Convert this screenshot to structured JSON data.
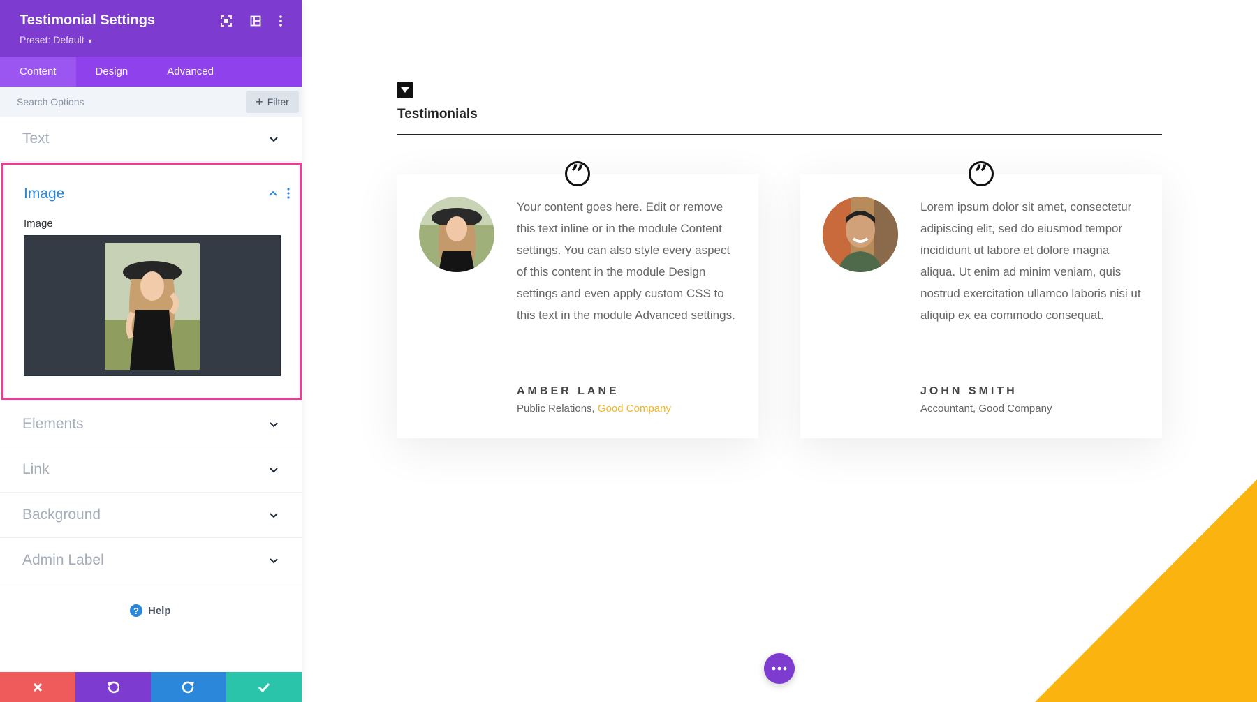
{
  "colors": {
    "header_purple": "#7e3bd0",
    "tab_bar_purple": "#8f42ec",
    "active_section_blue": "#2b87da",
    "highlight_pink": "#ea3d96",
    "cancel_red": "#ef5b5b",
    "redo_blue": "#2b87da",
    "save_teal": "#29c4a9",
    "accent_yellow": "#fbb40f",
    "company_link": "#f0b629"
  },
  "panel": {
    "title": "Testimonial Settings",
    "preset": "Preset: Default",
    "header_icons": [
      "expand-icon",
      "split-view-icon",
      "more-vertical-icon"
    ],
    "tabs": [
      {
        "label": "Content",
        "active": true
      },
      {
        "label": "Design",
        "active": false
      },
      {
        "label": "Advanced",
        "active": false
      }
    ],
    "search_placeholder": "Search Options",
    "filter_label": "Filter",
    "sections": {
      "text": "Text",
      "image": "Image",
      "elements": "Elements",
      "link": "Link",
      "background": "Background",
      "admin_label": "Admin Label"
    },
    "image_field_label": "Image",
    "help_label": "Help",
    "footer_icons": [
      "close-icon",
      "undo-icon",
      "redo-icon",
      "check-icon"
    ]
  },
  "canvas": {
    "module_title": "Testimonials",
    "testimonials": [
      {
        "body": "Your content goes here. Edit or remove this text inline or in the module Content settings. You can also style every aspect of this content in the module Design settings and even apply custom CSS to this text in the module Advanced settings.",
        "name": "AMBER LANE",
        "role": "Public Relations, ",
        "company": "Good Company",
        "avatar": "woman-in-hat-avatar"
      },
      {
        "body": "Lorem ipsum dolor sit amet, consectetur adipiscing elit, sed do eiusmod tempor incididunt ut labore et dolore magna aliqua. Ut enim ad minim veniam, quis nostrud exercitation ullamco laboris nisi ut aliquip ex ea commodo consequat.",
        "name": "JOHN SMITH",
        "role": "Accountant, Good Company",
        "avatar": "smiling-man-avatar"
      }
    ],
    "quote_glyph": "”"
  }
}
